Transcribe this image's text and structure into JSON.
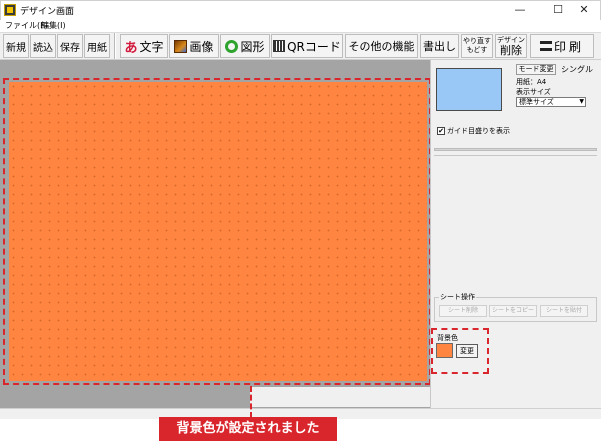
{
  "window": {
    "title": "デザイン画面",
    "controls": [
      "—",
      "☐",
      "✕"
    ]
  },
  "menu": [
    "ファイル(F)",
    "編集(I)"
  ],
  "toolbar": {
    "new": "新規",
    "load": "読込",
    "save": "保存",
    "paper": "用紙",
    "text": "文字",
    "text_glyph": "あ",
    "image": "画像",
    "shape": "図形",
    "qr": "QRコード",
    "other": "その他の機能",
    "export": "書出し",
    "redo": "やり直す",
    "undo": "もどす",
    "design_top": "デザイン",
    "design_delete": "削除",
    "print": "印刷"
  },
  "right_panel": {
    "mode_button": "モード変更",
    "mode_value": "シングル",
    "paper_label": "用紙：A4",
    "display_size_label": "表示サイズ",
    "display_size_value": "標準サイズ",
    "guide_checkbox": "ガイド目盛りを表示",
    "guide_checked": "✔",
    "sheet_ops_title": "シート操作",
    "sheet_buttons": [
      "シート削除",
      "シートをコピー",
      "シートを貼付"
    ],
    "background_label": "背景色",
    "background_change_button": "変更"
  },
  "colors": {
    "canvas": "#ff8540",
    "preview": "#99c8f7",
    "annotation": "#d9262c"
  },
  "annotation_banner": "背景色が設定されました"
}
